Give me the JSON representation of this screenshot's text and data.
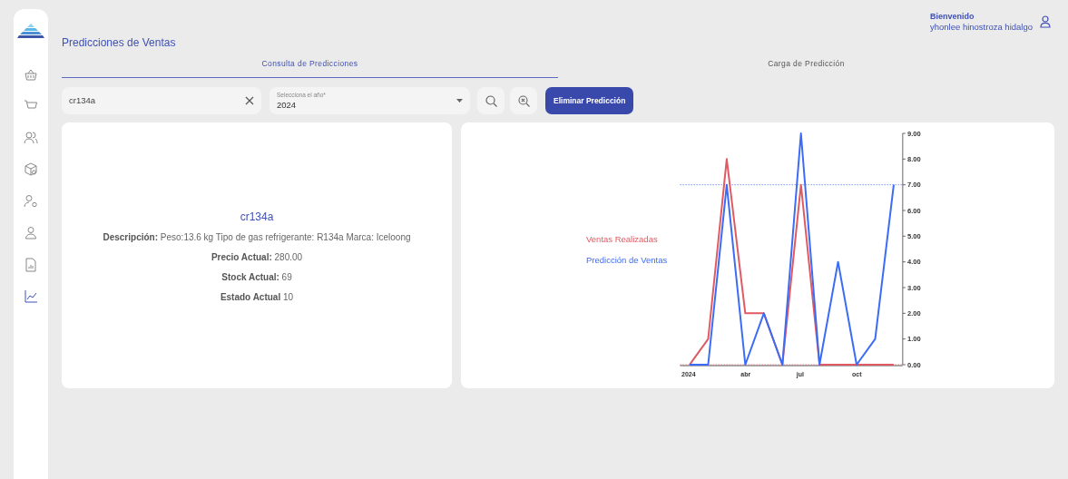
{
  "sidebar": {
    "items": [
      {
        "selected": false
      },
      {
        "selected": false
      },
      {
        "selected": false
      },
      {
        "selected": false
      },
      {
        "selected": false
      },
      {
        "selected": false
      },
      {
        "selected": false
      },
      {
        "selected": true
      }
    ]
  },
  "header": {
    "title": "Predicciones de Ventas",
    "greeting": "Bienvenido",
    "user_name": "yhonlee hinostroza hidalgo"
  },
  "tabs": [
    {
      "label": "Consulta de Predicciones",
      "selected": true
    },
    {
      "label": "Carga de Predicción",
      "selected": false
    }
  ],
  "search": {
    "value": "cr134a"
  },
  "year_select": {
    "label": "Selecciona el año*",
    "value": "2024"
  },
  "buttons": {
    "delete": "Eliminar Predicción"
  },
  "product": {
    "name": "cr134a",
    "lines": [
      "**Descripción:** Peso:13.6 kg Tipo de gas refrigerante: R134a Marca: Iceloong",
      "**Precio Actual:** 280.00",
      "**Stock Actual:** 69",
      "**Estado Actual** 10"
    ]
  },
  "chart": {
    "chart_data": {
      "type": "line",
      "x": [
        "2024-01",
        "2024-02",
        "2024-03",
        "2024-04",
        "2024-05",
        "2024-06",
        "2024-07",
        "2024-08",
        "2024-09",
        "2024-10",
        "2024-11",
        "2024-12"
      ],
      "xticks": [
        {
          "value": "2024-01",
          "label": "2024"
        },
        {
          "value": "2024-04",
          "label": "abr"
        },
        {
          "value": "2024-07",
          "label": "jul"
        },
        {
          "value": "2024-10",
          "label": "oct"
        }
      ],
      "xlim": [
        "2023-12-16",
        "2024-12-16"
      ],
      "ylim": [
        0,
        9
      ],
      "ref_lines": [
        {
          "axis": "y",
          "value": 0,
          "color": "#e05a63"
        },
        {
          "axis": "y",
          "value": 7,
          "color": "#3c6cf5"
        }
      ],
      "yticks": [
        {
          "value": 0,
          "label": "0.00"
        },
        {
          "value": 1,
          "label": "1.00"
        },
        {
          "value": 2,
          "label": "2.00"
        },
        {
          "value": 3,
          "label": "3.00"
        },
        {
          "value": 4,
          "label": "4.00"
        },
        {
          "value": 5,
          "label": "5.00"
        },
        {
          "value": 6,
          "label": "6.00"
        },
        {
          "value": 7,
          "label": "7.00"
        },
        {
          "value": 8,
          "label": "8.00"
        },
        {
          "value": 9,
          "label": "9.00"
        }
      ],
      "series": [
        {
          "name": "Ventas Realizadas",
          "color": "#e05a63",
          "values": [
            0,
            1,
            8,
            2,
            2,
            0,
            7,
            0,
            0,
            0,
            0,
            0
          ]
        },
        {
          "name": "Predicción de Ventas",
          "color": "#3c6cf5",
          "values": [
            0,
            0,
            7,
            0,
            2,
            0,
            9,
            0,
            4,
            0,
            1,
            7
          ]
        }
      ]
    }
  }
}
